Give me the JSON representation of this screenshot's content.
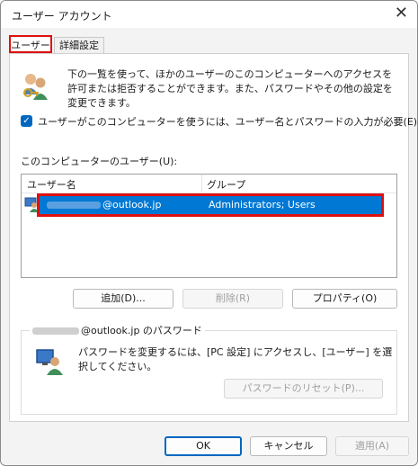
{
  "window": {
    "title": "ユーザー アカウント",
    "close": "✕"
  },
  "tabs": [
    {
      "label": "ユーザー",
      "active": true
    },
    {
      "label": "詳細設定",
      "active": false
    }
  ],
  "intro": {
    "text": "下の一覧を使って、ほかのユーザーのこのコンピューターへのアクセスを許可または拒否することができます。また、パスワードやその他の設定を変更できます。"
  },
  "require_login": {
    "checked": true,
    "label": "ユーザーがこのコンピューターを使うには、ユーザー名とパスワードの入力が必要(E)"
  },
  "users": {
    "label": "このコンピューターのユーザー(U):",
    "columns": [
      "ユーザー名",
      "グループ"
    ],
    "rows": [
      {
        "user": "@outlook.jp",
        "group": "Administrators; Users",
        "selected": true
      }
    ]
  },
  "user_buttons": {
    "add": "追加(D)...",
    "remove": "削除(R)",
    "properties": "プロパティ(O)"
  },
  "password_group": {
    "title": "@outlook.jp のパスワード",
    "text": "パスワードを変更するには、[PC 設定] にアクセスし、[ユーザー] を選択してください。",
    "reset_button": "パスワードのリセット(P)..."
  },
  "dialog_buttons": {
    "ok": "OK",
    "cancel": "キャンセル",
    "apply": "適用(A)"
  },
  "colors": {
    "selection": "#0078d4",
    "highlight_box": "#e01010",
    "checkbox": "#0067c0"
  }
}
